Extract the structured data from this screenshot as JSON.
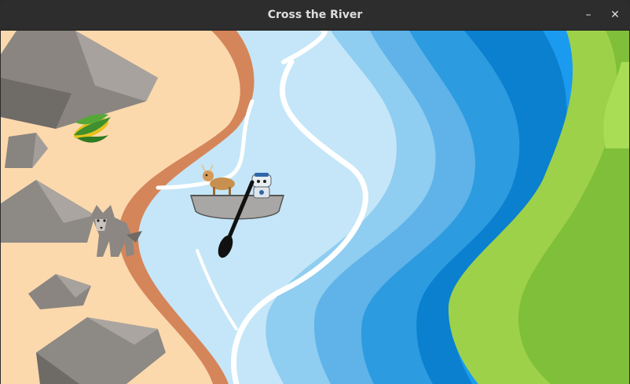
{
  "window": {
    "title": "Cross the River",
    "minimize_icon": "minimize-icon",
    "close_icon": "close-icon"
  },
  "game": {
    "characters": [
      {
        "id": "corn",
        "location": "left-bank"
      },
      {
        "id": "wolf",
        "location": "left-bank"
      },
      {
        "id": "goat",
        "location": "boat"
      },
      {
        "id": "farmer-robot",
        "location": "boat"
      }
    ],
    "colors": {
      "sand": "#fbd9ad",
      "bank": "#d5855a",
      "shallow_water": "#c4e6f8",
      "deep_water": "#0a80cf",
      "grass": "#9ed14a"
    }
  }
}
